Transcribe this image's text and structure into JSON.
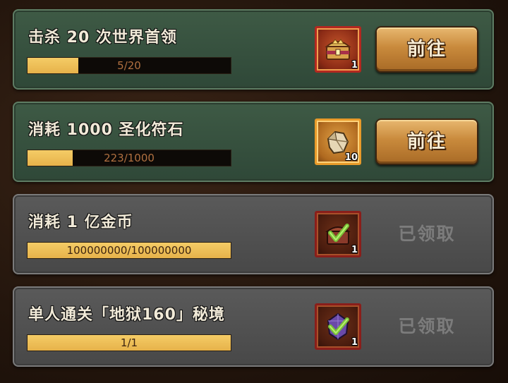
{
  "tasks": [
    {
      "title": "击杀 20 次世界首领",
      "progress_text": "5/20",
      "progress": 0.25,
      "status": "active",
      "reward": {
        "icon": "treasure-chest-icon",
        "qty": "1"
      },
      "action_label": "前往"
    },
    {
      "title": "消耗 1000 圣化符石",
      "progress_text": "223/1000",
      "progress": 0.223,
      "status": "active",
      "reward": {
        "icon": "rune-stone-icon",
        "qty": "10"
      },
      "action_label": "前往"
    },
    {
      "title": "消耗 1 亿金币",
      "progress_text": "100000000/100000000",
      "progress": 1.0,
      "status": "claimed",
      "reward": {
        "icon": "green-chest-icon",
        "qty": "1"
      },
      "action_label": "已领取"
    },
    {
      "title": "单人通关「地狱160」秘境",
      "progress_text": "1/1",
      "progress": 1.0,
      "status": "claimed",
      "reward": {
        "icon": "purple-gem-icon",
        "qty": "1"
      },
      "action_label": "已领取"
    }
  ],
  "colors": {
    "active_card": "#3e5a45",
    "claimed_card": "#535353",
    "progress_fill": "#f0c35a",
    "button": "#c98a3c"
  }
}
